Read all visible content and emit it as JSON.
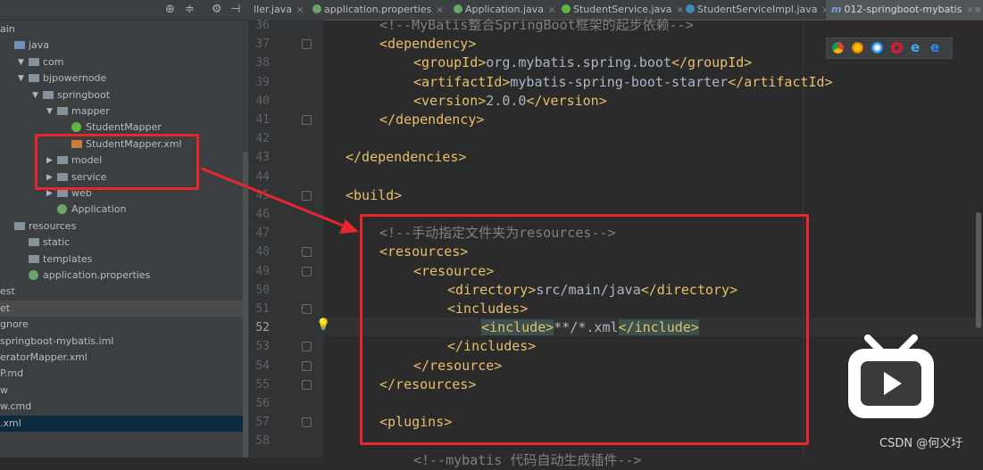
{
  "sidebar": {
    "rows": [
      {
        "text": "ain",
        "kind": "plain"
      },
      {
        "text": "java",
        "kind": "folder-blue"
      },
      {
        "text": "com",
        "kind": "folder",
        "tri": "▼"
      },
      {
        "text": "bjpowernode",
        "kind": "folder",
        "tri": "▼"
      },
      {
        "text": "springboot",
        "kind": "folder",
        "tri": "▼"
      },
      {
        "text": "mapper",
        "kind": "folder",
        "tri": "▼"
      },
      {
        "text": "StudentMapper",
        "kind": "interface"
      },
      {
        "text": "StudentMapper.xml",
        "kind": "xml"
      },
      {
        "text": "model",
        "kind": "folder",
        "tri": "▶"
      },
      {
        "text": "service",
        "kind": "folder",
        "tri": "▶"
      },
      {
        "text": "web",
        "kind": "folder",
        "tri": "▶"
      },
      {
        "text": "Application",
        "kind": "spring"
      },
      {
        "text": "resources",
        "kind": "folder"
      },
      {
        "text": "static",
        "kind": "folder"
      },
      {
        "text": "templates",
        "kind": "folder"
      },
      {
        "text": "application.properties",
        "kind": "spring"
      },
      {
        "text": "est",
        "kind": "plain"
      },
      {
        "text": "et",
        "kind": "plain"
      },
      {
        "text": "gnore",
        "kind": "plain"
      },
      {
        "text": "springboot-mybatis.iml",
        "kind": "plain"
      },
      {
        "text": "eratorMapper.xml",
        "kind": "plain"
      },
      {
        "text": "P.md",
        "kind": "plain"
      },
      {
        "text": "w",
        "kind": "plain"
      },
      {
        "text": "w.cmd",
        "kind": "plain"
      },
      {
        "text": ".xml",
        "kind": "plain"
      }
    ]
  },
  "tabs": [
    {
      "label": "ller.java",
      "icon": "none"
    },
    {
      "label": "application.properties",
      "icon": "spring"
    },
    {
      "label": "Application.java",
      "icon": "spring"
    },
    {
      "label": "StudentService.java",
      "icon": "interface"
    },
    {
      "label": "StudentServiceImpl.java",
      "icon": "class"
    },
    {
      "label": "012-springboot-mybatis",
      "icon": "maven",
      "suffix": "×≡"
    }
  ],
  "editor": {
    "lines": [
      {
        "n": "36",
        "indent": 1,
        "parts": [
          [
            "cm",
            "<!--MyBatis整合SpringBoot框架的起步依赖-->"
          ]
        ]
      },
      {
        "n": "37",
        "indent": 1,
        "parts": [
          [
            "tag",
            "<dependency>"
          ]
        ]
      },
      {
        "n": "38",
        "indent": 2,
        "parts": [
          [
            "tag",
            "<groupId>"
          ],
          [
            "txt",
            "org.mybatis.spring.boot"
          ],
          [
            "tag",
            "</groupId>"
          ]
        ]
      },
      {
        "n": "39",
        "indent": 2,
        "parts": [
          [
            "tag",
            "<artifactId>"
          ],
          [
            "txt",
            "mybatis-spring-boot-starter"
          ],
          [
            "tag",
            "</artifactId>"
          ]
        ]
      },
      {
        "n": "40",
        "indent": 2,
        "parts": [
          [
            "tag",
            "<version>"
          ],
          [
            "txt",
            "2.0.0"
          ],
          [
            "tag",
            "</version>"
          ]
        ]
      },
      {
        "n": "41",
        "indent": 1,
        "parts": [
          [
            "tag",
            "</dependency>"
          ]
        ]
      },
      {
        "n": "42",
        "indent": 0,
        "parts": []
      },
      {
        "n": "43",
        "indent": 0,
        "parts": [
          [
            "tag",
            "</dependencies>"
          ]
        ]
      },
      {
        "n": "44",
        "indent": 0,
        "parts": []
      },
      {
        "n": "45",
        "indent": 0,
        "parts": [
          [
            "tag",
            "<build>"
          ]
        ]
      },
      {
        "n": "46",
        "indent": 0,
        "parts": []
      },
      {
        "n": "47",
        "indent": 1,
        "parts": [
          [
            "cm",
            "<!--手动指定文件夹为resources-->"
          ]
        ]
      },
      {
        "n": "48",
        "indent": 1,
        "parts": [
          [
            "tag",
            "<resources>"
          ]
        ]
      },
      {
        "n": "49",
        "indent": 2,
        "parts": [
          [
            "tag",
            "<resource>"
          ]
        ]
      },
      {
        "n": "50",
        "indent": 3,
        "parts": [
          [
            "tag",
            "<directory>"
          ],
          [
            "txt",
            "src/main/java"
          ],
          [
            "tag",
            "</directory>"
          ]
        ]
      },
      {
        "n": "51",
        "indent": 3,
        "parts": [
          [
            "tag",
            "<includes>"
          ]
        ]
      },
      {
        "n": "52",
        "indent": 4,
        "parts": [
          [
            "tag-hl",
            "<include>"
          ],
          [
            "txt",
            "**/*.xml"
          ],
          [
            "tag-hl",
            "</include>"
          ]
        ]
      },
      {
        "n": "53",
        "indent": 3,
        "parts": [
          [
            "tag",
            "</includes>"
          ]
        ]
      },
      {
        "n": "54",
        "indent": 2,
        "parts": [
          [
            "tag",
            "</resource>"
          ]
        ]
      },
      {
        "n": "55",
        "indent": 1,
        "parts": [
          [
            "tag",
            "</resources>"
          ]
        ]
      },
      {
        "n": "56",
        "indent": 0,
        "parts": []
      },
      {
        "n": "57",
        "indent": 1,
        "parts": [
          [
            "tag",
            "<plugins>"
          ]
        ]
      },
      {
        "n": "58",
        "indent": 0,
        "parts": []
      },
      {
        "n": "",
        "indent": 2,
        "parts": [
          [
            "cm",
            "<!--mybatis 代码自动生成插件-->"
          ]
        ]
      }
    ]
  },
  "watermark": "CSDN @何义圩",
  "colors": {
    "annotation_red": "#e8272d",
    "tag": "#e8bf6a",
    "comment": "#808080"
  }
}
